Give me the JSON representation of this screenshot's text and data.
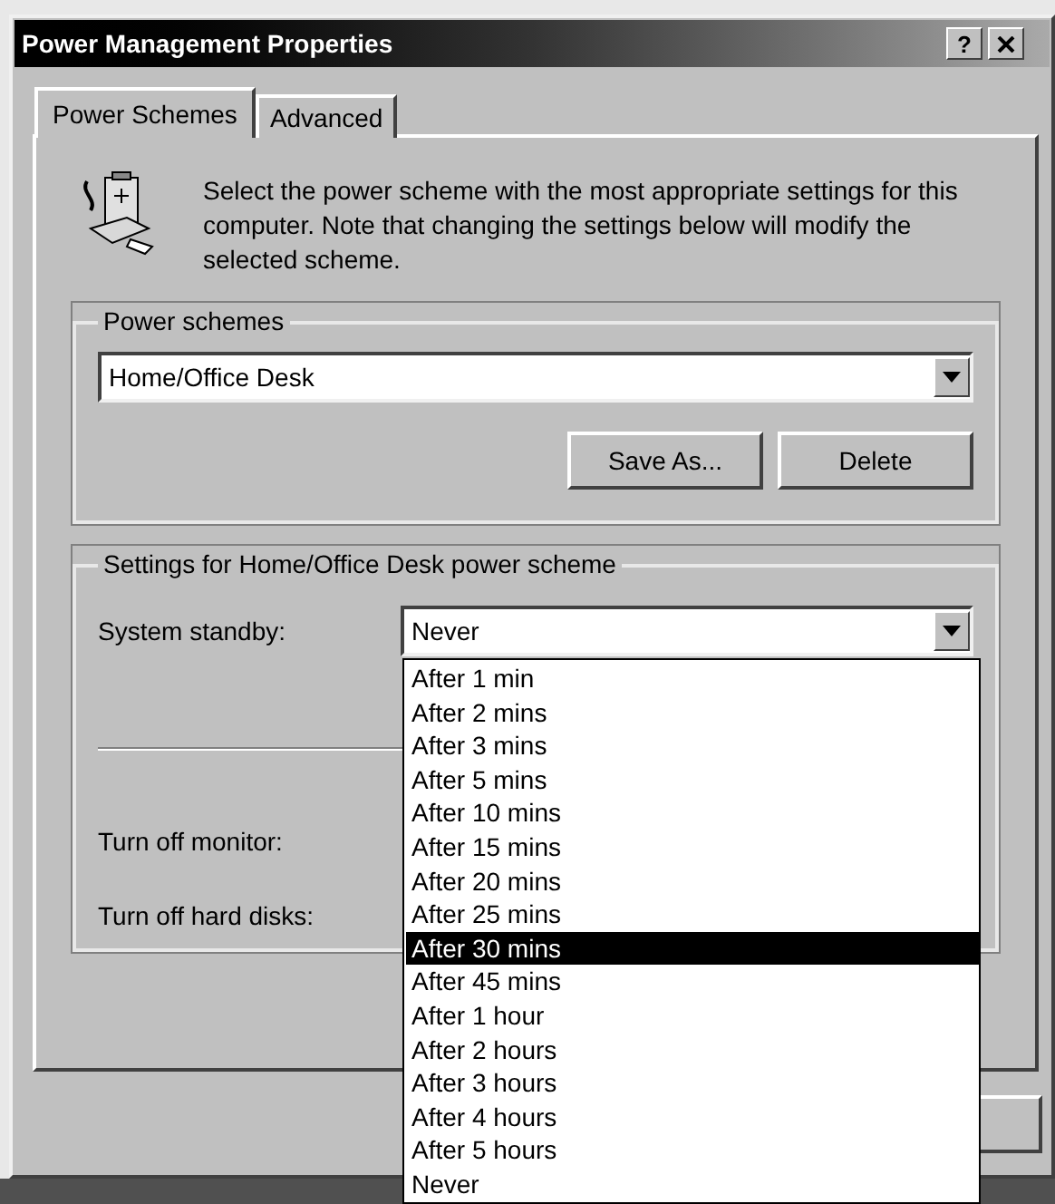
{
  "window": {
    "title": "Power Management Properties",
    "help_button": "?"
  },
  "tabs": [
    {
      "label": "Power Schemes",
      "selected": true
    },
    {
      "label": "Advanced",
      "selected": false
    }
  ],
  "intro": "Select the power scheme with the most appropriate settings for this computer. Note that changing the settings below will modify the selected scheme.",
  "power_schemes": {
    "label": "Power schemes",
    "value": "Home/Office Desk",
    "buttons": [
      "Save As...",
      "Delete"
    ]
  },
  "settings": {
    "label": "Settings for Home/Office Desk power scheme",
    "rows": [
      {
        "label": "System standby:",
        "value": "Never"
      },
      {
        "label": "Turn off monitor:"
      },
      {
        "label": "Turn off hard disks:"
      }
    ]
  },
  "dropdown_list": [
    {
      "label": "After 1 min",
      "selected": false
    },
    {
      "label": "After 2 mins",
      "selected": false
    },
    {
      "label": "After 3 mins",
      "selected": false
    },
    {
      "label": "After 5 mins",
      "selected": false
    },
    {
      "label": "After 10 mins",
      "selected": false
    },
    {
      "label": "After 15 mins",
      "selected": false
    },
    {
      "label": "After 20 mins",
      "selected": false
    },
    {
      "label": "After 25 mins",
      "selected": false
    },
    {
      "label": "After 30 mins",
      "selected": true
    },
    {
      "label": "After 45 mins",
      "selected": false
    },
    {
      "label": "After 1 hour",
      "selected": false
    },
    {
      "label": "After 2 hours",
      "selected": false
    },
    {
      "label": "After 3 hours",
      "selected": false
    },
    {
      "label": "After 4 hours",
      "selected": false
    },
    {
      "label": "After 5 hours",
      "selected": false
    },
    {
      "label": "Never",
      "selected": false
    }
  ]
}
